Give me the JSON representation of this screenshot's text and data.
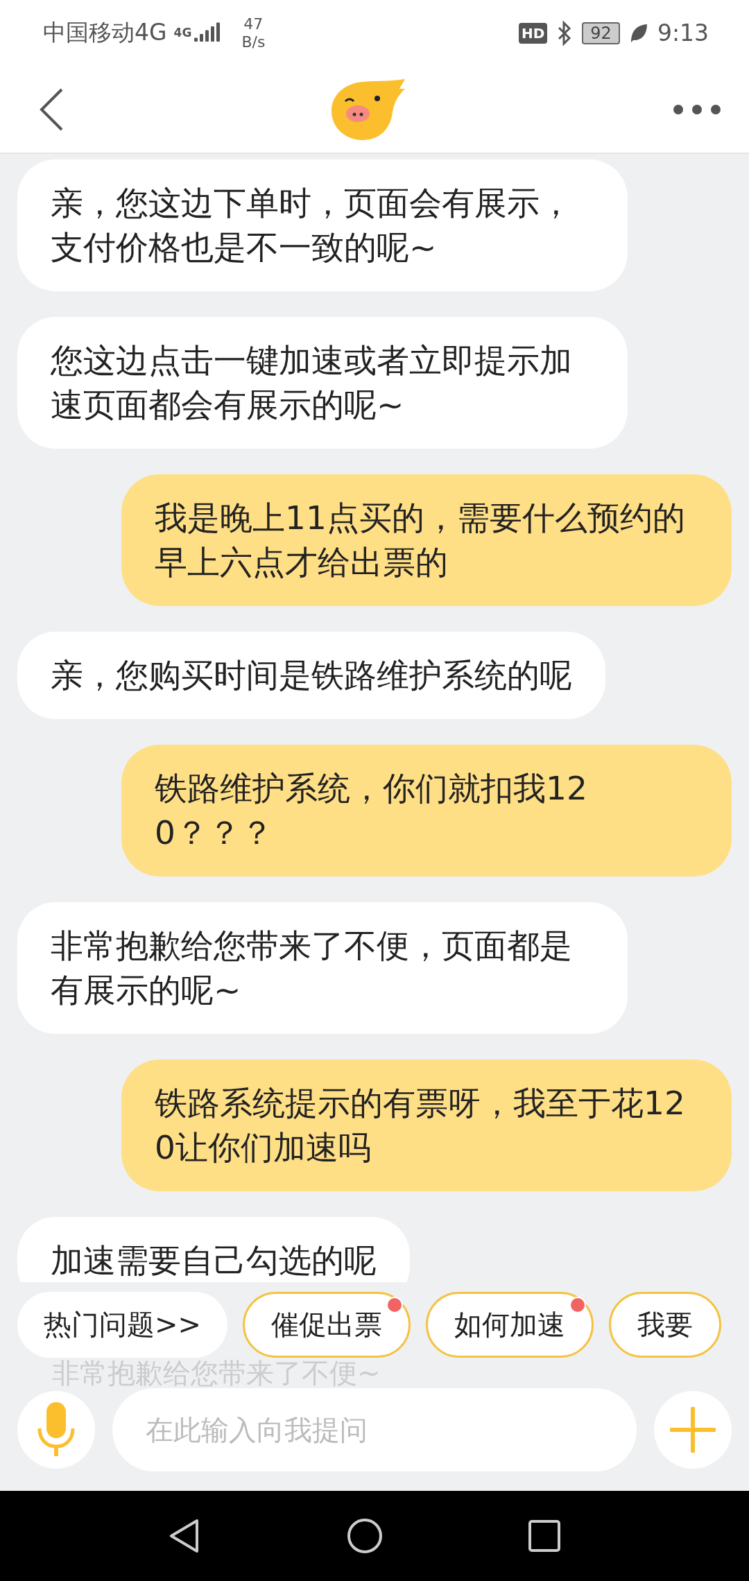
{
  "status_bar": {
    "carrier": "中国移动4G",
    "network_type": "4G",
    "speed_value": "47",
    "speed_unit": "B/s",
    "hd": "HD",
    "battery": "92",
    "time": "9:13"
  },
  "messages": [
    {
      "kind": "incoming",
      "text": "亲，您这边下单时，页面会有展示，支付价格也是不一致的呢~"
    },
    {
      "kind": "incoming",
      "text": "您这边点击一键加速或者立即提示加速页面都会有展示的呢~"
    },
    {
      "kind": "outgoing",
      "text": "我是晚上11点买的，需要什么预约的早上六点才给出票的"
    },
    {
      "kind": "incoming",
      "text": "亲，您购买时间是铁路维护系统的呢"
    },
    {
      "kind": "outgoing",
      "text": "铁路维护系统，你们就扣我120？？？"
    },
    {
      "kind": "incoming",
      "text": "非常抱歉给您带来了不便，页面都是有展示的呢~"
    },
    {
      "kind": "outgoing",
      "text": "铁路系统提示的有票呀，我至于花120让你们加速吗"
    },
    {
      "kind": "incoming",
      "text": "加速需要自己勾选的呢"
    }
  ],
  "quick_replies": [
    {
      "kind": "plain",
      "label": "热门问题>>",
      "unread": false
    },
    {
      "kind": "topic",
      "label": "催促出票",
      "unread": true
    },
    {
      "kind": "topic",
      "label": "如何加速",
      "unread": true
    },
    {
      "kind": "topic",
      "label": "我要",
      "unread": false
    }
  ],
  "faded_message": "非常抱歉给您带来了不便~",
  "input": {
    "placeholder": "在此输入向我提问"
  }
}
